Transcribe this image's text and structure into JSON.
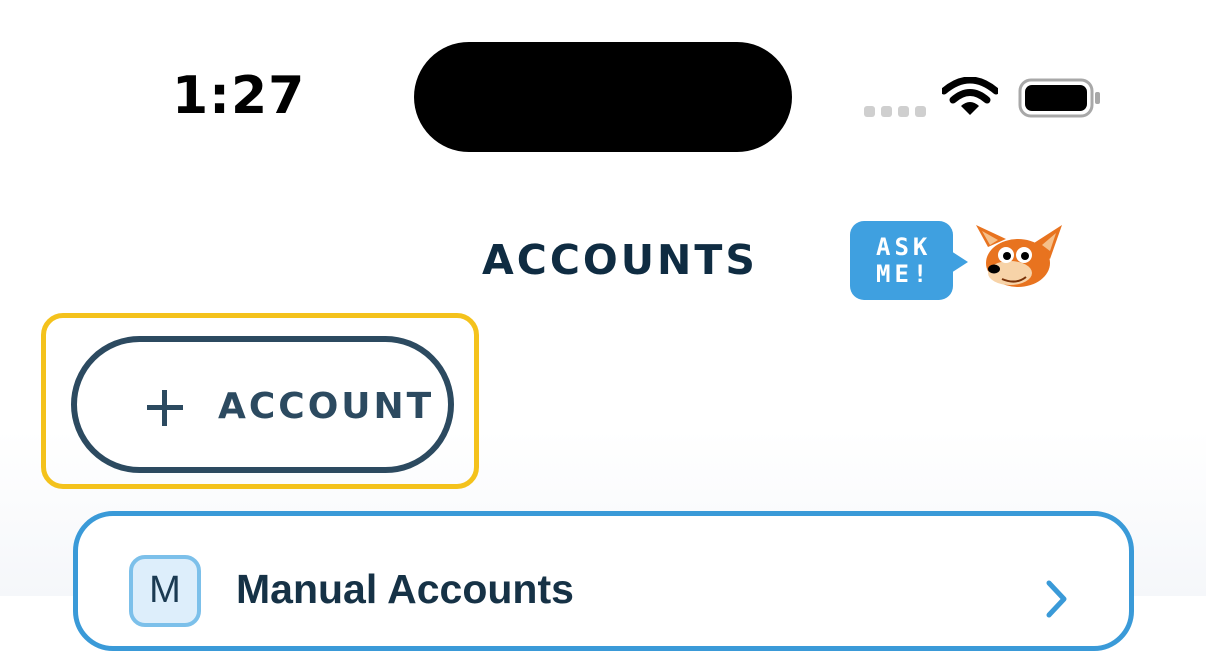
{
  "status_bar": {
    "time": "1:27"
  },
  "header": {
    "title": "ACCOUNTS",
    "ask_me": {
      "line1": "ASK",
      "line2": "ME!"
    }
  },
  "add_button": {
    "label": "ACCOUNT",
    "icon": "plus-icon"
  },
  "accounts": [
    {
      "badge": "M",
      "title": "Manual Accounts",
      "icon": "chevron-right-icon"
    }
  ],
  "colors": {
    "title": "#0f2c42",
    "button_border": "#2c4a60",
    "card_border": "#3a9ad8",
    "highlight": "#f4c21c",
    "ask_bubble": "#3fa0e0"
  }
}
